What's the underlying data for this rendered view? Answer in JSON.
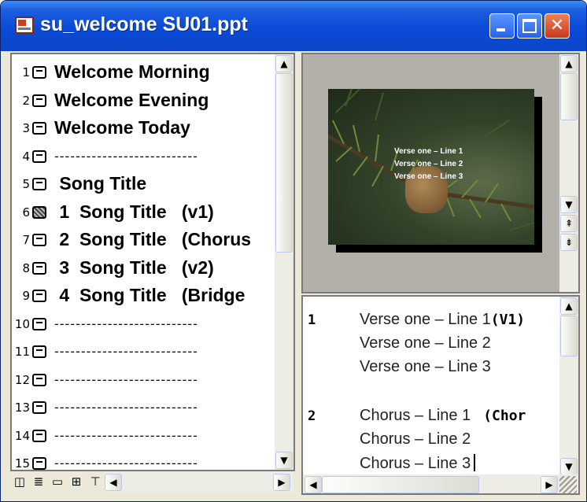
{
  "window": {
    "title": "su_welcome SU01.ppt"
  },
  "outline": {
    "rows": [
      {
        "num": "1",
        "text": "Welcome Morning",
        "selected": false
      },
      {
        "num": "2",
        "text": "Welcome Evening",
        "selected": false
      },
      {
        "num": "3",
        "text": "Welcome Today",
        "selected": false
      },
      {
        "num": "4",
        "text": "---------------------------",
        "selected": false
      },
      {
        "num": "5",
        "text": " Song Title",
        "selected": false
      },
      {
        "num": "6",
        "text": " 1  Song Title   (v1)",
        "selected": true
      },
      {
        "num": "7",
        "text": " 2  Song Title   (Chorus",
        "selected": false
      },
      {
        "num": "8",
        "text": " 3  Song Title   (v2)",
        "selected": false
      },
      {
        "num": "9",
        "text": " 4  Song Title   (Bridge",
        "selected": false
      },
      {
        "num": "10",
        "text": "---------------------------",
        "selected": false
      },
      {
        "num": "11",
        "text": "---------------------------",
        "selected": false
      },
      {
        "num": "12",
        "text": "---------------------------",
        "selected": false
      },
      {
        "num": "13",
        "text": "---------------------------",
        "selected": false
      },
      {
        "num": "14",
        "text": "---------------------------",
        "selected": false
      },
      {
        "num": "15",
        "text": "---------------------------",
        "selected": false
      }
    ]
  },
  "view_buttons": [
    "normal-view-icon",
    "outline-view-icon",
    "slide-view-icon",
    "slide-sorter-icon",
    "slideshow-icon"
  ],
  "slide_preview": {
    "lines": [
      "Verse one – Line 1",
      "Verse one – Line 2",
      "Verse one – Line 3"
    ],
    "colors": {
      "background": "#2c3a24",
      "text": "#ffffff"
    }
  },
  "notes": {
    "blocks": [
      {
        "num": "1",
        "lines": [
          "Verse one – Line 1",
          "Verse one – Line 2",
          "Verse one – Line 3"
        ],
        "tag": "(V1)"
      },
      {
        "num": "2",
        "lines": [
          "Chorus – Line 1",
          "Chorus – Line 2",
          "Chorus – Line 3"
        ],
        "tag": "(Chor"
      }
    ]
  },
  "colors": {
    "titlebar": "#0a4ad8",
    "frame": "#ece9d8",
    "close_button": "#d8502c"
  }
}
